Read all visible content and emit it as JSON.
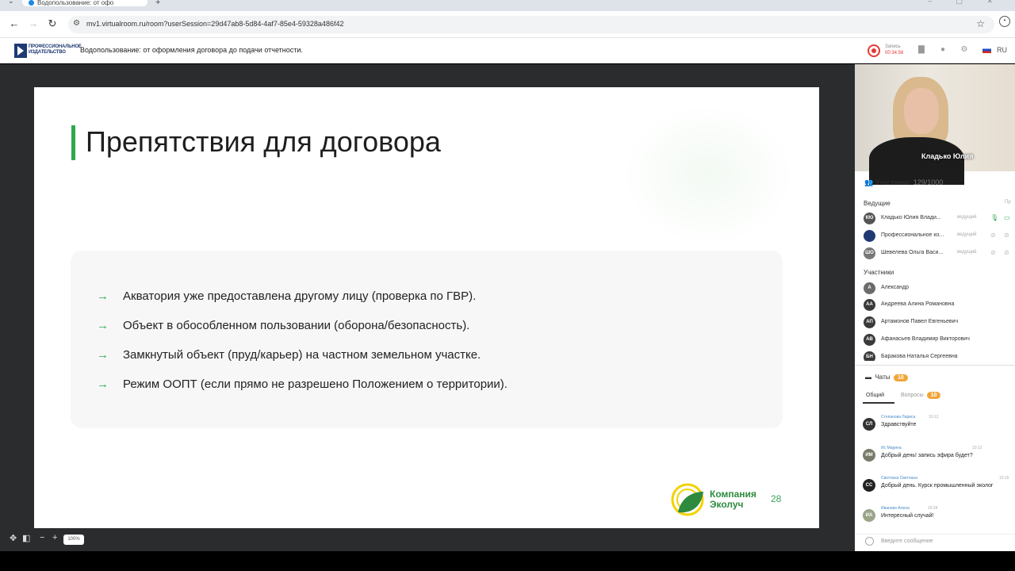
{
  "browser": {
    "tab_title": "Водопользование: от офо",
    "new_tab": "+",
    "url": "mv1.virtualroom.ru/room?userSession=29d47ab8-5d84-4af7-85e4-59328a486f42",
    "back": "←",
    "forward": "→",
    "reload": "↻",
    "star": "☆",
    "window_controls": "– ▢ ✕"
  },
  "header": {
    "logo_text": "ПРОФЕССИОНАЛЬНОЕ ИЗДАТЕЛЬСТВО",
    "title": "Водопользование: от оформления договора до подачи отчетности.",
    "rec_label": "Запись",
    "rec_time": "00:34:56",
    "lang": "RU"
  },
  "slide": {
    "title": "Препятствия для договора",
    "bullets": [
      "Акватория уже предоставлена другому лицу (проверка по ГВР).",
      "Объект в обособленном пользовании (оборона/безопасность).",
      "Замкнутый объект (пруд/карьер) на частном земельном участке.",
      "Режим ООПТ (если прямо не разрешено Положением о территории)."
    ],
    "bullet_arrow": "→",
    "company": "Компания\nЭколуч",
    "page": "28"
  },
  "viewer": {
    "zoom": "100%"
  },
  "video": {
    "speaker": "Кладько Юлия"
  },
  "participants": {
    "label": "Участники",
    "count": "129/1000",
    "hosts_label": "Ведущие",
    "rights_label": "Пр",
    "hosts": [
      {
        "initials": "КЮ",
        "name": "Кладько Юлия Влади...",
        "role": "ведущий"
      },
      {
        "initials": "",
        "name": "Профессиональное из...",
        "role": "ведущий"
      },
      {
        "initials": "ШО",
        "name": "Шевелева Ольга Васи...",
        "role": "ведущий"
      }
    ],
    "members_label": "Участники",
    "members": [
      {
        "initials": "А",
        "name": "Александр"
      },
      {
        "initials": "АА",
        "name": "Андреева Алина Романовна"
      },
      {
        "initials": "АП",
        "name": "Артамонов Павел Евгеньевич"
      },
      {
        "initials": "АВ",
        "name": "Афанасьев Владимир Викторович"
      },
      {
        "initials": "БН",
        "name": "Баракова Наталья Сергеевна"
      }
    ]
  },
  "chat": {
    "label": "Чаты",
    "badge": "10",
    "tab_general": "Общий",
    "tab_questions": "Вопросы",
    "questions_badge": "10",
    "messages": [
      {
        "initials": "СЛ",
        "author": "Степанова Лариса",
        "time": "10:12",
        "text": "Здравствуйте"
      },
      {
        "initials": "ИМ",
        "author": "Ис Марина",
        "time": "10:12",
        "text": "Добрый день! запись эфира будет?"
      },
      {
        "initials": "СС",
        "author": "Светлана Светлана",
        "time": "10:15",
        "text": "Добрый день. Курск промышленный эколог"
      },
      {
        "initials": "ИА",
        "author": "Иванова Алена",
        "time": "10:24",
        "text": "Интересный случай!"
      }
    ],
    "input_placeholder": "Введите сообщение"
  }
}
